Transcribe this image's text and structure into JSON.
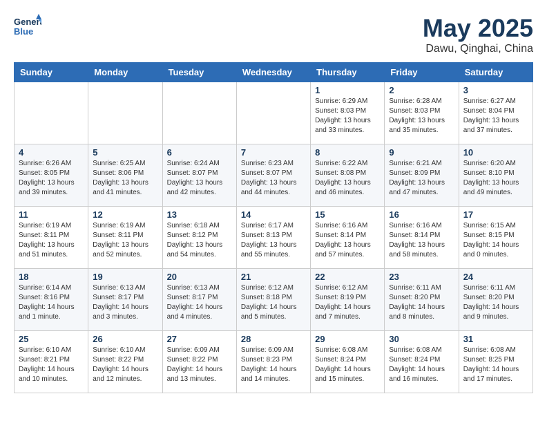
{
  "logo": {
    "line1": "General",
    "line2": "Blue"
  },
  "title": "May 2025",
  "location": "Dawu, Qinghai, China",
  "days_of_week": [
    "Sunday",
    "Monday",
    "Tuesday",
    "Wednesday",
    "Thursday",
    "Friday",
    "Saturday"
  ],
  "weeks": [
    [
      {
        "day": "",
        "info": ""
      },
      {
        "day": "",
        "info": ""
      },
      {
        "day": "",
        "info": ""
      },
      {
        "day": "",
        "info": ""
      },
      {
        "day": "1",
        "info": "Sunrise: 6:29 AM\nSunset: 8:03 PM\nDaylight: 13 hours\nand 33 minutes."
      },
      {
        "day": "2",
        "info": "Sunrise: 6:28 AM\nSunset: 8:03 PM\nDaylight: 13 hours\nand 35 minutes."
      },
      {
        "day": "3",
        "info": "Sunrise: 6:27 AM\nSunset: 8:04 PM\nDaylight: 13 hours\nand 37 minutes."
      }
    ],
    [
      {
        "day": "4",
        "info": "Sunrise: 6:26 AM\nSunset: 8:05 PM\nDaylight: 13 hours\nand 39 minutes."
      },
      {
        "day": "5",
        "info": "Sunrise: 6:25 AM\nSunset: 8:06 PM\nDaylight: 13 hours\nand 41 minutes."
      },
      {
        "day": "6",
        "info": "Sunrise: 6:24 AM\nSunset: 8:07 PM\nDaylight: 13 hours\nand 42 minutes."
      },
      {
        "day": "7",
        "info": "Sunrise: 6:23 AM\nSunset: 8:07 PM\nDaylight: 13 hours\nand 44 minutes."
      },
      {
        "day": "8",
        "info": "Sunrise: 6:22 AM\nSunset: 8:08 PM\nDaylight: 13 hours\nand 46 minutes."
      },
      {
        "day": "9",
        "info": "Sunrise: 6:21 AM\nSunset: 8:09 PM\nDaylight: 13 hours\nand 47 minutes."
      },
      {
        "day": "10",
        "info": "Sunrise: 6:20 AM\nSunset: 8:10 PM\nDaylight: 13 hours\nand 49 minutes."
      }
    ],
    [
      {
        "day": "11",
        "info": "Sunrise: 6:19 AM\nSunset: 8:11 PM\nDaylight: 13 hours\nand 51 minutes."
      },
      {
        "day": "12",
        "info": "Sunrise: 6:19 AM\nSunset: 8:11 PM\nDaylight: 13 hours\nand 52 minutes."
      },
      {
        "day": "13",
        "info": "Sunrise: 6:18 AM\nSunset: 8:12 PM\nDaylight: 13 hours\nand 54 minutes."
      },
      {
        "day": "14",
        "info": "Sunrise: 6:17 AM\nSunset: 8:13 PM\nDaylight: 13 hours\nand 55 minutes."
      },
      {
        "day": "15",
        "info": "Sunrise: 6:16 AM\nSunset: 8:14 PM\nDaylight: 13 hours\nand 57 minutes."
      },
      {
        "day": "16",
        "info": "Sunrise: 6:16 AM\nSunset: 8:14 PM\nDaylight: 13 hours\nand 58 minutes."
      },
      {
        "day": "17",
        "info": "Sunrise: 6:15 AM\nSunset: 8:15 PM\nDaylight: 14 hours\nand 0 minutes."
      }
    ],
    [
      {
        "day": "18",
        "info": "Sunrise: 6:14 AM\nSunset: 8:16 PM\nDaylight: 14 hours\nand 1 minute."
      },
      {
        "day": "19",
        "info": "Sunrise: 6:13 AM\nSunset: 8:17 PM\nDaylight: 14 hours\nand 3 minutes."
      },
      {
        "day": "20",
        "info": "Sunrise: 6:13 AM\nSunset: 8:17 PM\nDaylight: 14 hours\nand 4 minutes."
      },
      {
        "day": "21",
        "info": "Sunrise: 6:12 AM\nSunset: 8:18 PM\nDaylight: 14 hours\nand 5 minutes."
      },
      {
        "day": "22",
        "info": "Sunrise: 6:12 AM\nSunset: 8:19 PM\nDaylight: 14 hours\nand 7 minutes."
      },
      {
        "day": "23",
        "info": "Sunrise: 6:11 AM\nSunset: 8:20 PM\nDaylight: 14 hours\nand 8 minutes."
      },
      {
        "day": "24",
        "info": "Sunrise: 6:11 AM\nSunset: 8:20 PM\nDaylight: 14 hours\nand 9 minutes."
      }
    ],
    [
      {
        "day": "25",
        "info": "Sunrise: 6:10 AM\nSunset: 8:21 PM\nDaylight: 14 hours\nand 10 minutes."
      },
      {
        "day": "26",
        "info": "Sunrise: 6:10 AM\nSunset: 8:22 PM\nDaylight: 14 hours\nand 12 minutes."
      },
      {
        "day": "27",
        "info": "Sunrise: 6:09 AM\nSunset: 8:22 PM\nDaylight: 14 hours\nand 13 minutes."
      },
      {
        "day": "28",
        "info": "Sunrise: 6:09 AM\nSunset: 8:23 PM\nDaylight: 14 hours\nand 14 minutes."
      },
      {
        "day": "29",
        "info": "Sunrise: 6:08 AM\nSunset: 8:24 PM\nDaylight: 14 hours\nand 15 minutes."
      },
      {
        "day": "30",
        "info": "Sunrise: 6:08 AM\nSunset: 8:24 PM\nDaylight: 14 hours\nand 16 minutes."
      },
      {
        "day": "31",
        "info": "Sunrise: 6:08 AM\nSunset: 8:25 PM\nDaylight: 14 hours\nand 17 minutes."
      }
    ]
  ]
}
